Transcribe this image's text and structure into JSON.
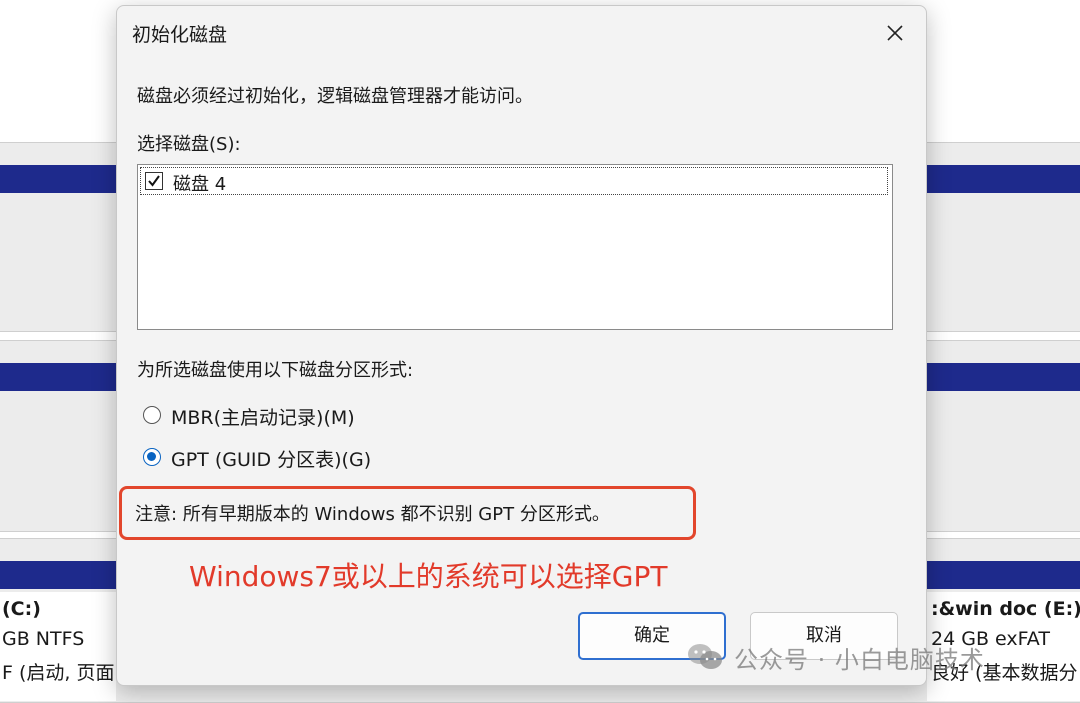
{
  "background": {
    "left_volume": {
      "name": "(C:)",
      "size": "GB NTFS",
      "status": "F (启动, 页面"
    },
    "right_volume": {
      "name": ":&win doc  (E:)",
      "size": "24 GB exFAT",
      "status": "良好 (基本数据分"
    }
  },
  "dialog": {
    "title": "初始化磁盘",
    "intro": "磁盘必须经过初始化，逻辑磁盘管理器才能访问。",
    "select_label": "选择磁盘(S):",
    "disks": [
      {
        "label": "磁盘 4",
        "checked": true
      }
    ],
    "partition_label": "为所选磁盘使用以下磁盘分区形式:",
    "options": [
      {
        "label": "MBR(主启动记录)(M)",
        "checked": false
      },
      {
        "label": "GPT (GUID 分区表)(G)",
        "checked": true
      }
    ],
    "note": "注意: 所有早期版本的 Windows 都不识别 GPT 分区形式。",
    "ok_label": "确定",
    "cancel_label": "取消"
  },
  "annotation": {
    "text": "Windows7或以上的系统可以选择GPT",
    "color": "#e23a2a"
  },
  "watermark": {
    "text": "公众号 · 小白电脑技术"
  },
  "colors": {
    "accent": "#0a64c2",
    "volume_bar": "#1e2a8c",
    "highlight": "#e2462c"
  }
}
